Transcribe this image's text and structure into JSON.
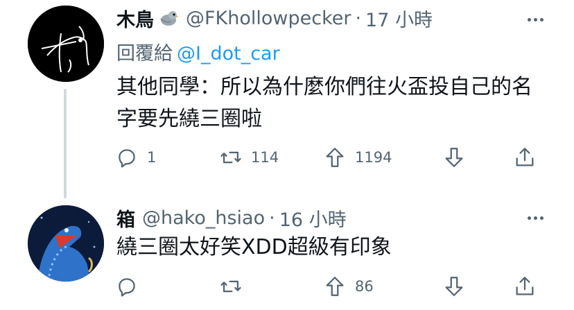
{
  "tweets": [
    {
      "name": "木鳥",
      "handle": "@FKhollowpecker",
      "dot": "·",
      "time": "17 小時",
      "reply_prefix": "回覆給",
      "reply_handle": "@I_dot_car",
      "text": "其他同學：所以為什麼你們往火盃投自己的名字要先繞三圈啦",
      "counts": {
        "reply": "1",
        "retweet": "114",
        "upvote": "1194"
      },
      "avatar_icon": "white-bird-scribble-avatar",
      "badge_icon": "bird-emoji-icon"
    },
    {
      "name": "箱",
      "handle": "@hako_hsiao",
      "dot": "·",
      "time": "16 小時",
      "text": "繞三圈太好笑XDD超級有印象",
      "counts": {
        "reply": "",
        "retweet": "",
        "upvote": "86"
      },
      "avatar_icon": "blue-whale-creature-avatar"
    }
  ],
  "colors": {
    "text": "#0f1419",
    "secondary": "#536471",
    "link": "#1d9bf0",
    "thread": "#cfd9de"
  }
}
